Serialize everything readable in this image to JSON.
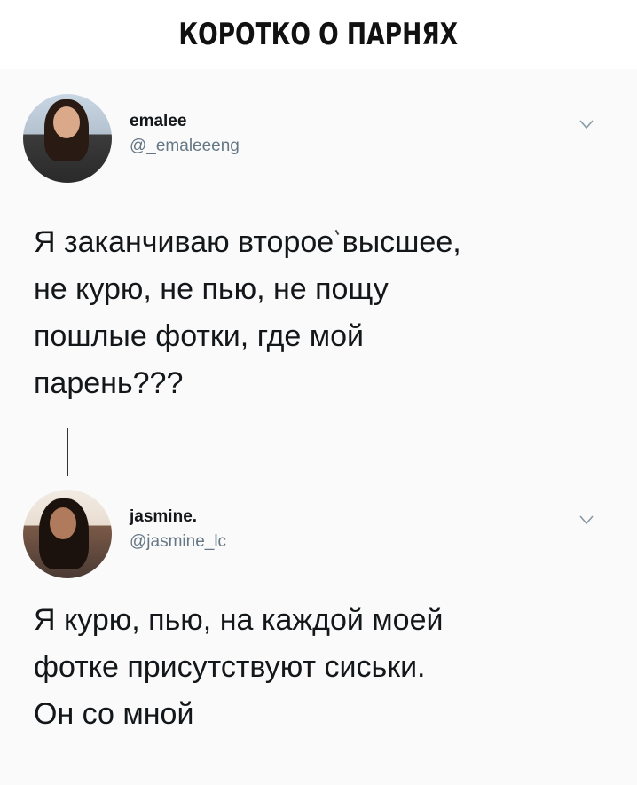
{
  "header": {
    "title": "КОРОТКО О ПАРНЯХ"
  },
  "tweets": [
    {
      "display_name": "emalee",
      "handle": "@_emaleeeng",
      "text_lines": [
        "Я заканчиваю второе высшее,",
        "не курю, не пью, не пощу",
        "пошлые фотки, где мой",
        "парень???"
      ]
    },
    {
      "display_name": "jasmine.",
      "handle": "@jasmine_lc",
      "text_lines": [
        "Я курю, пью, на каждой моей",
        "фотке присутствуют сиськи.",
        "Он со мной"
      ]
    }
  ],
  "icons": {
    "menu": "chevron-down-icon"
  },
  "colors": {
    "name": "#14171a",
    "handle": "#657786",
    "background": "#fafafa"
  }
}
